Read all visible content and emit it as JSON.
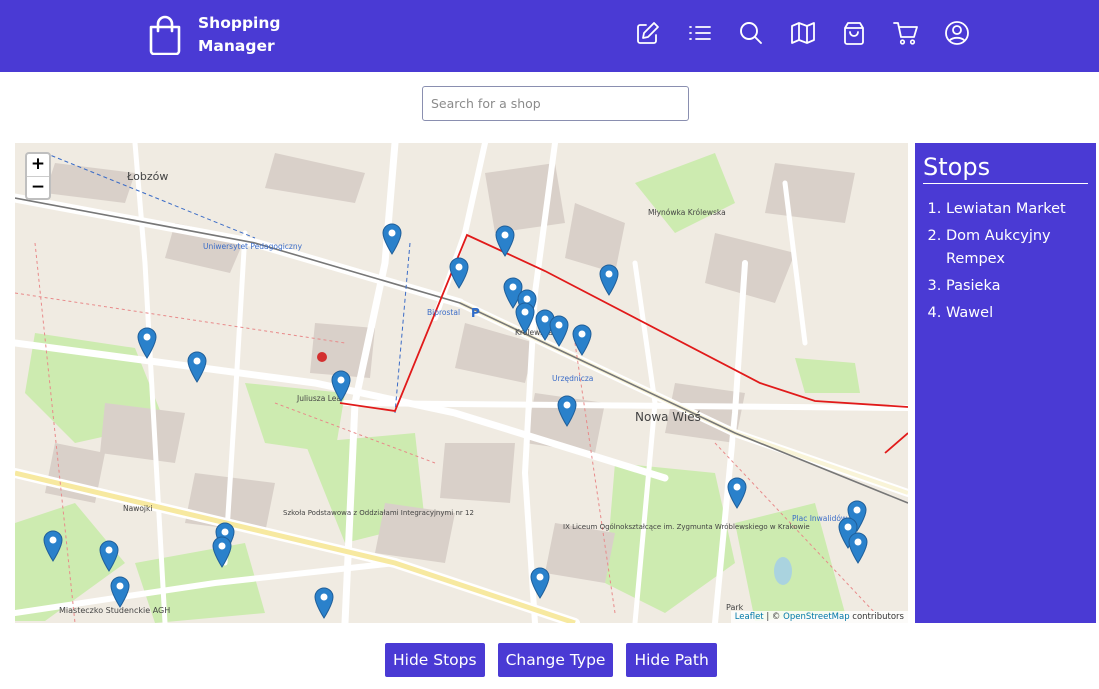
{
  "app": {
    "title_line1": "Shopping",
    "title_line2": "Manager"
  },
  "nav": [
    {
      "icon": "edit-icon"
    },
    {
      "icon": "list-icon"
    },
    {
      "icon": "search-icon"
    },
    {
      "icon": "map-icon"
    },
    {
      "icon": "shopping-bag-icon"
    },
    {
      "icon": "cart-icon"
    },
    {
      "icon": "user-icon"
    }
  ],
  "search": {
    "placeholder": "Search for a shop",
    "value": ""
  },
  "map": {
    "zoom_in": "+",
    "zoom_out": "−",
    "attribution_leaflet": "Leaflet",
    "attribution_sep": " | © ",
    "attribution_osm": "OpenStreetMap",
    "attribution_tail": " contributors",
    "street_labels": [
      "Łobzów",
      "Nowa Wieś",
      "Juliusza Lea",
      "Królewska",
      "Urzędnicza",
      "Nawojki",
      "Plac Inwalidów",
      "Szkoła Podstawowa z Oddziałami Integracyjnymi nr 12",
      "IX Liceum Ogólnokształcące im. Zygmunta Wróblewskiego w Krakowie",
      "Miasteczko Studenckie AGH",
      "Bipro­stal",
      "Uniwersytet Pedagogiczny",
      "Młynówka Królewska",
      "Park"
    ]
  },
  "colors": {
    "brand": "#4a3ad4",
    "route": "#e11a1a",
    "marker": "#2a81cb"
  },
  "stops": {
    "title": "Stops",
    "items": [
      "Lewiatan Market",
      "Dom Aukcyjny Rempex",
      "Pasieka",
      "Wawel"
    ]
  },
  "actions": {
    "hide_stops": "Hide Stops",
    "change_type": "Change Type",
    "hide_path": "Hide Path"
  }
}
